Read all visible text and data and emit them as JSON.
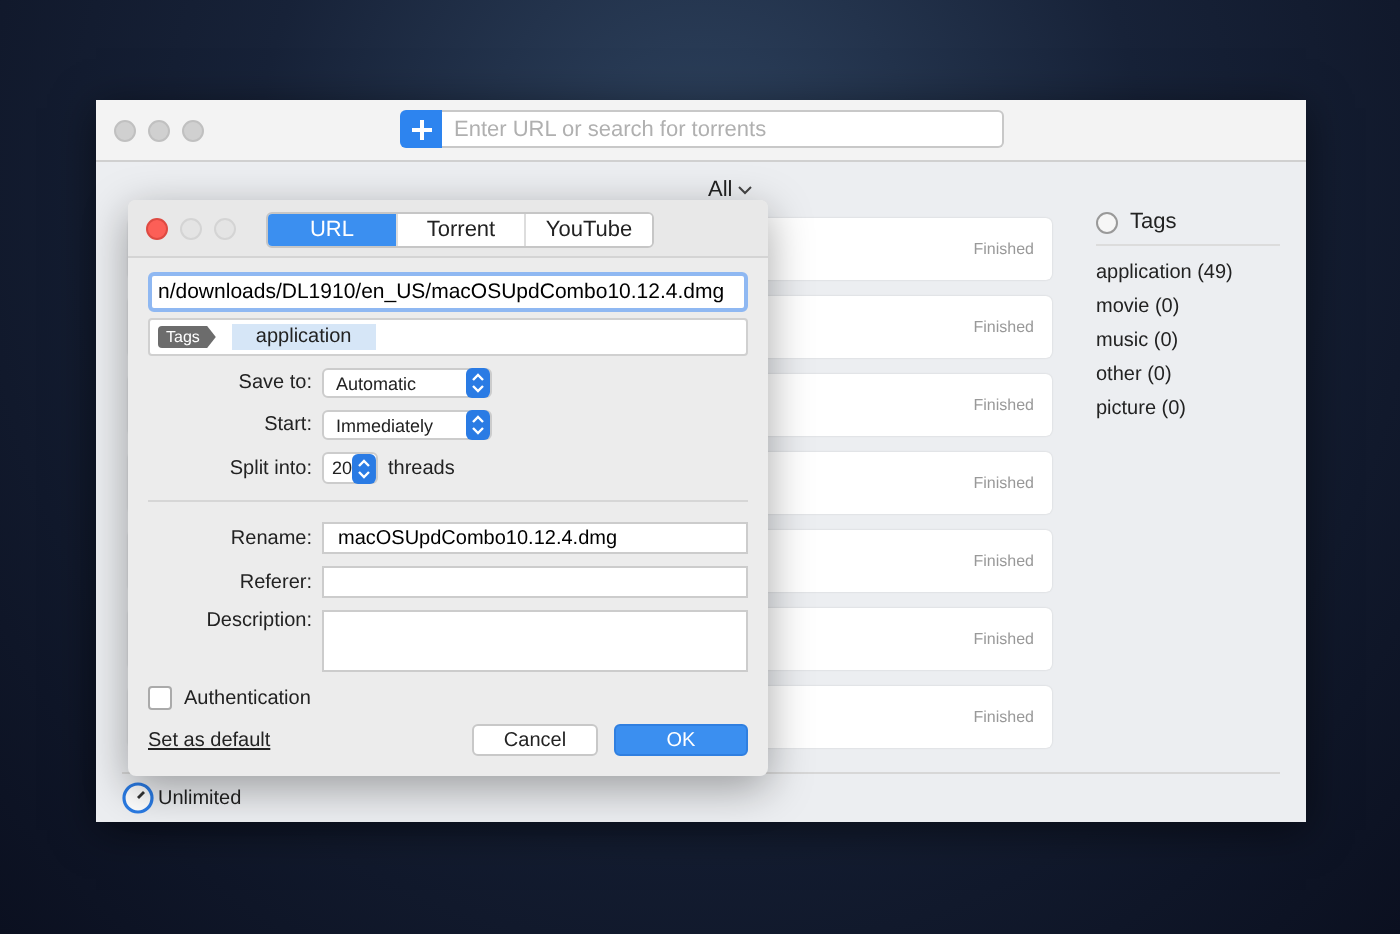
{
  "window": {
    "search": {
      "placeholder": "Enter URL or search for torrents"
    },
    "filter": "All",
    "downloads": [
      {
        "status": "Finished"
      },
      {
        "status": "Finished"
      },
      {
        "status": "Finished"
      },
      {
        "status": "Finished"
      },
      {
        "status": "Finished"
      },
      {
        "status": "Finished"
      },
      {
        "status": "Finished"
      }
    ],
    "tags_panel": {
      "title": "Tags",
      "selected": false,
      "items": [
        "application (49)",
        "movie (0)",
        "music (0)",
        "other (0)",
        "picture (0)"
      ]
    },
    "speed_limit": "Unlimited"
  },
  "dialog": {
    "tabs": [
      {
        "label": "URL",
        "selected": true
      },
      {
        "label": "Torrent",
        "selected": false
      },
      {
        "label": "YouTube",
        "selected": false
      }
    ],
    "url": "n/downloads/DL1910/en_US/macOSUpdCombo10.12.4.dmg",
    "tag_label": "Tags",
    "tags": [
      "application"
    ],
    "options": [
      {
        "kind": "popup",
        "label": "Save to:",
        "value": "Automatic"
      },
      {
        "kind": "popup",
        "label": "Start:",
        "value": "Immediately"
      },
      {
        "kind": "stepper",
        "label": "Split into:",
        "value": "20",
        "unit": "threads"
      }
    ],
    "details": [
      {
        "kind": "text",
        "label": "Rename:",
        "value": "macOSUpdCombo10.12.4.dmg"
      },
      {
        "kind": "text",
        "label": "Referer:"
      },
      {
        "kind": "textarea",
        "label": "Description:"
      }
    ],
    "authentication": {
      "label": "Authentication",
      "checked": false
    },
    "set_default": "Set as default",
    "buttons": [
      {
        "label": "Cancel",
        "kind": "secondary"
      },
      {
        "label": "OK",
        "kind": "primary"
      }
    ]
  }
}
